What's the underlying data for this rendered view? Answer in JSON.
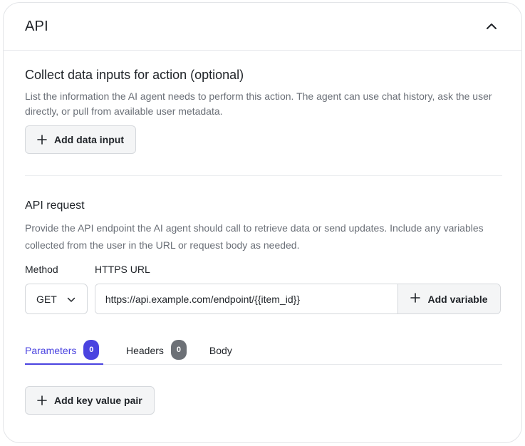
{
  "header": {
    "title": "API"
  },
  "data_inputs": {
    "title": "Collect data inputs for action (optional)",
    "description": "List the information the AI agent needs to perform this action. The agent can use chat history, ask the user directly, or pull from available user metadata.",
    "add_button_label": "Add data input"
  },
  "api_request": {
    "title": "API request",
    "description": "Provide the API endpoint the AI agent should call to retrieve data or send updates. Include any variables collected from the user in the URL or request body as needed.",
    "method_label": "Method",
    "url_label": "HTTPS URL",
    "method_value": "GET",
    "url_value": "https://api.example.com/endpoint/{{item_id}}",
    "add_variable_label": "Add variable"
  },
  "tabs": [
    {
      "label": "Parameters",
      "count": "0",
      "active": true
    },
    {
      "label": "Headers",
      "count": "0",
      "active": false
    },
    {
      "label": "Body",
      "active": false
    }
  ],
  "params": {
    "add_pair_label": "Add key value pair"
  },
  "colors": {
    "accent": "#4a43e0",
    "badge_gray": "#6c7076",
    "border": "#d5d8dc",
    "muted_text": "#6a6f77"
  },
  "icons": {
    "collapse": "chevron-up-icon",
    "method_dropdown": "chevron-down-icon",
    "add": "plus-icon"
  }
}
